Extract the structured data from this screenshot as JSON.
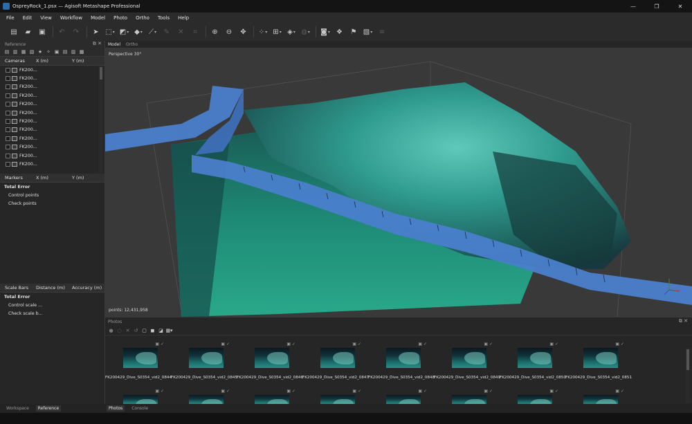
{
  "window": {
    "title": "OspreyRock_1.psx — Agisoft Metashape Professional",
    "controls": [
      "—",
      "❐",
      "✕"
    ]
  },
  "menu": [
    "File",
    "Edit",
    "View",
    "Workflow",
    "Model",
    "Photo",
    "Ortho",
    "Tools",
    "Help"
  ],
  "toolbar": {
    "icons": [
      "new-icon",
      "open-icon",
      "save-icon",
      "undo-icon",
      "redo-icon",
      "pointer-icon",
      "rectangle-select-icon",
      "region-icon",
      "shape-icon",
      "ruler-icon",
      "brush-icon",
      "delete-icon",
      "crop-icon",
      "zoom-in-icon",
      "zoom-out-icon",
      "move-icon",
      "points-icon",
      "grid-icon",
      "model-icon",
      "globe-icon",
      "camera-icon",
      "texture-icon",
      "flag-icon",
      "image-icon",
      "layers-icon"
    ]
  },
  "reference": {
    "title": "Reference",
    "cameras_header": {
      "name": "Cameras",
      "x": "X (m)",
      "y": "Y (m)"
    },
    "cameras": [
      "FK200...",
      "FK200...",
      "FK200...",
      "FK200...",
      "FK200...",
      "FK200...",
      "FK200...",
      "FK200...",
      "FK200...",
      "FK200...",
      "FK200...",
      "FK200..."
    ],
    "markers_header": {
      "name": "Markers",
      "x": "X (m)",
      "y": "Y (m)"
    },
    "markers_rows": {
      "total": "Total Error",
      "control": "Control points",
      "check": "Check points"
    },
    "scalebars_header": {
      "name": "Scale Bars",
      "distance": "Distance (m)",
      "accuracy": "Accuracy (m)"
    },
    "scalebars_rows": {
      "total": "Total Error",
      "control": "Control scale ...",
      "check": "Check scale b..."
    }
  },
  "viewport": {
    "tabs": [
      "Model",
      "Ortho"
    ],
    "view_label": "Perspective 30°",
    "points_label": "points: 12,431,958",
    "colors": {
      "background": "#393939",
      "terrain": "#1e8a76",
      "rock": "#2f9a8e",
      "cameras": "#4a7fcc"
    }
  },
  "photos": {
    "title": "Photos",
    "row1": [
      "FK200429_Dive_S0354_vid2_0844",
      "FK200429_Dive_S0354_vid2_0845",
      "FK200429_Dive_S0354_vid2_0846",
      "FK200429_Dive_S0354_vid2_0847",
      "FK200429_Dive_S0354_vid2_0848",
      "FK200429_Dive_S0354_vid2_0849",
      "FK200429_Dive_S0354_vid2_0850",
      "FK200429_Dive_S0354_vid2_0851"
    ]
  },
  "bottom_tabs_left": [
    "Workspace",
    "Reference"
  ],
  "bottom_tabs_right": [
    "Photos",
    "Console"
  ]
}
